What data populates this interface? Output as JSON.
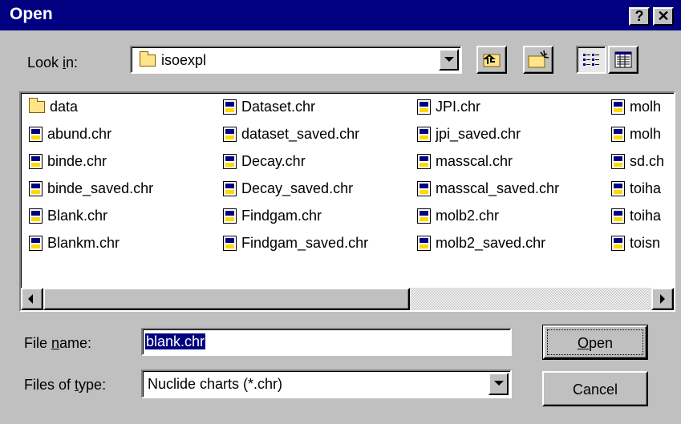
{
  "window": {
    "title": "Open",
    "help_button": "?",
    "close_button": "✕"
  },
  "look_in": {
    "label_pre": "Look ",
    "label_accel": "i",
    "label_post": "n:",
    "folder": "isoexpl"
  },
  "files": {
    "col1": [
      "data",
      "abund.chr",
      "binde.chr",
      "binde_saved.chr",
      "Blank.chr",
      "Blankm.chr"
    ],
    "col2": [
      "Dataset.chr",
      "dataset_saved.chr",
      "Decay.chr",
      "Decay_saved.chr",
      "Findgam.chr",
      "Findgam_saved.chr"
    ],
    "col3": [
      "JPI.chr",
      "jpi_saved.chr",
      "masscal.chr",
      "masscal_saved.chr",
      "molb2.chr",
      "molb2_saved.chr"
    ],
    "col4": [
      "molh",
      "molh",
      "sd.ch",
      "toiha",
      "toiha",
      "toisn"
    ]
  },
  "file_name": {
    "label_pre": "File ",
    "label_accel": "n",
    "label_post": "ame:",
    "value": "blank.chr"
  },
  "file_type": {
    "label_pre": "Files of ",
    "label_accel": "t",
    "label_post": "ype:",
    "value": "Nuclide charts (*.chr)"
  },
  "buttons": {
    "open_accel": "O",
    "open_rest": "pen",
    "cancel": "Cancel"
  },
  "colors": {
    "title_bg": "#000080",
    "face": "#c0c0c0",
    "selection": "#000080"
  }
}
